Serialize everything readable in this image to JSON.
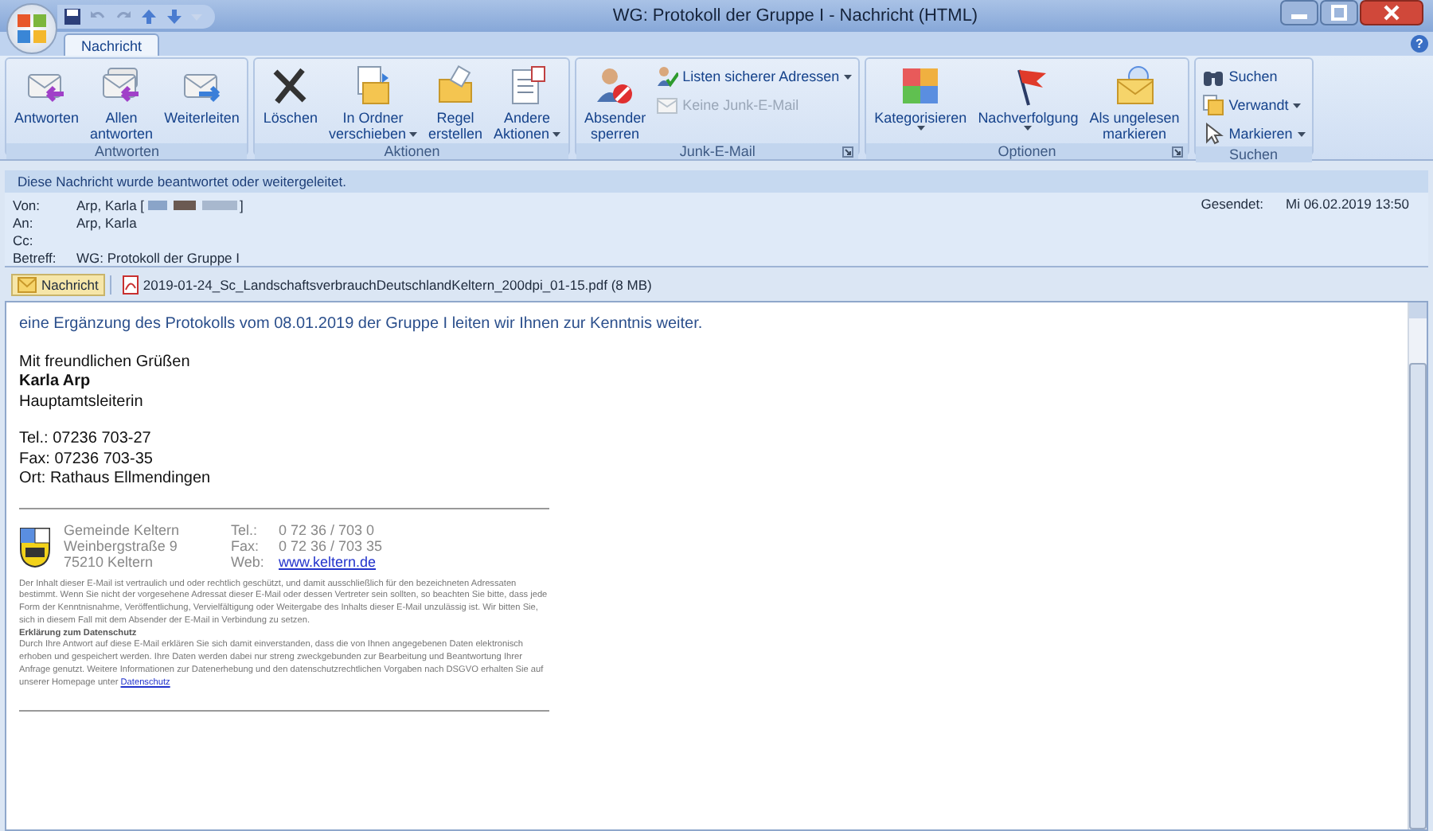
{
  "window": {
    "title": "WG: Protokoll der Gruppe I - Nachricht (HTML)",
    "help_glyph": "?"
  },
  "tabs": [
    {
      "label": "Nachricht",
      "selected": true
    }
  ],
  "ribbon_groups": [
    {
      "label": "Antworten",
      "launcher": false,
      "buttons": [
        {
          "kind": "large",
          "lines": [
            "Antworten"
          ],
          "dropdown": false
        },
        {
          "kind": "large",
          "lines": [
            "Allen",
            "antworten"
          ],
          "dropdown": false
        },
        {
          "kind": "large",
          "lines": [
            "Weiterleiten"
          ],
          "dropdown": false
        }
      ]
    },
    {
      "label": "Aktionen",
      "launcher": false,
      "buttons": [
        {
          "kind": "large",
          "lines": [
            "Löschen"
          ],
          "dropdown": false
        },
        {
          "kind": "large",
          "lines": [
            "In Ordner",
            "verschieben"
          ],
          "dropdown": true
        },
        {
          "kind": "large",
          "lines": [
            "Regel",
            "erstellen"
          ],
          "dropdown": false
        },
        {
          "kind": "large",
          "lines": [
            "Andere",
            "Aktionen"
          ],
          "dropdown": true
        }
      ]
    },
    {
      "label": "Junk-E-Mail",
      "launcher": true,
      "buttons": [
        {
          "kind": "large",
          "lines": [
            "Absender",
            "sperren"
          ],
          "dropdown": false
        },
        {
          "kind": "small",
          "lines": [
            "Listen sicherer Adressen"
          ],
          "dropdown": true,
          "disabled": false
        },
        {
          "kind": "small",
          "lines": [
            "Keine Junk-E-Mail"
          ],
          "dropdown": false,
          "disabled": true
        }
      ]
    },
    {
      "label": "Optionen",
      "launcher": true,
      "buttons": [
        {
          "kind": "large",
          "lines": [
            "Kategorisieren"
          ],
          "dropdown": true
        },
        {
          "kind": "large",
          "lines": [
            "Nachverfolgung"
          ],
          "dropdown": true
        },
        {
          "kind": "large",
          "lines": [
            "Als ungelesen",
            "markieren"
          ],
          "dropdown": false
        }
      ]
    },
    {
      "label": "Suchen",
      "launcher": false,
      "buttons": [
        {
          "kind": "small",
          "lines": [
            "Suchen"
          ],
          "dropdown": false,
          "disabled": false
        },
        {
          "kind": "small",
          "lines": [
            "Verwandt"
          ],
          "dropdown": true,
          "disabled": false
        },
        {
          "kind": "small",
          "lines": [
            "Markieren"
          ],
          "dropdown": true,
          "disabled": false
        }
      ]
    }
  ],
  "info_bar": "Diese Nachricht wurde beantwortet oder weitergeleitet.",
  "header": {
    "fields": [
      {
        "label": "Von:",
        "value": "Arp, Karla [",
        "redacted": true,
        "value_end": "]"
      },
      {
        "label": "An:",
        "value": "Arp, Karla",
        "redacted": false
      },
      {
        "label": "Cc:",
        "redacted": false
      },
      {
        "label": "Betreff:",
        "value": "WG: Protokoll der Gruppe I",
        "redacted": false
      }
    ],
    "sent": {
      "label": "Gesendet:",
      "value": "Mi 06.02.2019 13:50"
    }
  },
  "attachments": [
    {
      "kind": "message",
      "label": "Nachricht",
      "selected": true
    },
    {
      "kind": "pdf",
      "label": "2019-01-24_Sc_LandschaftsverbrauchDeutschlandKeltern_200dpi_01-15.pdf (8 MB)",
      "selected": false
    }
  ],
  "body": {
    "blocks": [
      {
        "kind": "intro",
        "lines": [
          {
            "text": "eine Ergänzung des Protokolls vom 08.01.2019 der Gruppe I leiten wir Ihnen zur Kenntnis weiter.",
            "bold": false
          }
        ]
      },
      {
        "kind": "plain",
        "lines": [
          {
            "text": "Mit freundlichen Grüßen",
            "bold": false
          },
          {
            "text": "Karla Arp",
            "bold": true
          },
          {
            "text": "Hauptamtsleiterin",
            "bold": false
          }
        ]
      },
      {
        "kind": "plain",
        "lines": [
          {
            "text": "Tel.: 07236 703-27",
            "bold": false
          },
          {
            "text": "Fax: 07236 703-35",
            "bold": false
          },
          {
            "text": "Ort: Rathaus Ellmendingen",
            "bold": false
          }
        ]
      }
    ],
    "signature": {
      "address": [
        "Gemeinde Keltern",
        "Weinbergstraße 9",
        "75210 Keltern"
      ],
      "contacts": [
        {
          "label": "Tel.:",
          "value": "0 72 36 / 703 0",
          "link": false
        },
        {
          "label": "Fax:",
          "value": "0 72 36 / 703 35",
          "link": false
        },
        {
          "label": "Web:",
          "value": "www.keltern.de",
          "link": true
        }
      ],
      "disclaimer": "Der Inhalt dieser E-Mail ist vertraulich und oder rechtlich geschützt, und damit ausschließlich für den bezeichneten Adressaten bestimmt. Wenn Sie nicht der vorgesehene Adressat dieser E-Mail oder dessen Vertreter sein sollten, so beachten Sie bitte, dass jede Form der Kenntnisnahme, Veröffentlichung, Vervielfältigung oder Weitergabe des Inhalts dieser E-Mail unzulässig ist. Wir bitten Sie, sich in diesem Fall mit dem Absender der E-Mail in Verbindung zu setzen.",
      "privacy_heading": "Erklärung zum Datenschutz",
      "privacy_text": "Durch Ihre Antwort auf diese E-Mail erklären Sie sich damit einverstanden, dass die von Ihnen angegebenen Daten elektronisch erhoben und gespeichert werden. Ihre Daten werden dabei nur streng zweckgebunden zur Bearbeitung und Beantwortung Ihrer Anfrage genutzt. Weitere Informationen zur Datenerhebung und den datenschutzrechtlichen Vorgaben nach DSGVO erhalten Sie auf unserer Homepage unter",
      "privacy_link": "Datenschutz"
    }
  }
}
